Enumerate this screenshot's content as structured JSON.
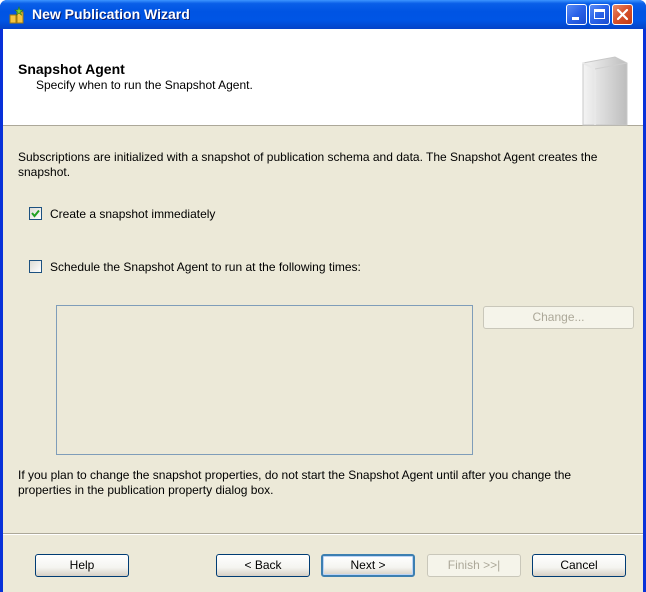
{
  "window": {
    "title": "New Publication Wizard"
  },
  "header": {
    "title": "Snapshot Agent",
    "subtitle": "Specify when to run the Snapshot Agent."
  },
  "intro_text": "Subscriptions are initialized with a snapshot of publication schema and data. The Snapshot Agent creates the snapshot.",
  "options": {
    "create_snapshot": {
      "label": "Create a snapshot immediately",
      "checked": true
    },
    "schedule_agent": {
      "label": "Schedule the Snapshot Agent to run at the following times:",
      "checked": false
    }
  },
  "schedule": {
    "change_label": "Change..."
  },
  "note_text": "If you plan to change the snapshot properties, do not start the Snapshot Agent until after you change the properties in the publication property dialog box.",
  "buttons": {
    "help": "Help",
    "back": "< Back",
    "next": "Next >",
    "finish": "Finish >>|",
    "cancel": "Cancel"
  },
  "colors": {
    "title_bar": "#0054e3",
    "dialog_face": "#ece9d8",
    "header_bg": "#ffffff"
  }
}
